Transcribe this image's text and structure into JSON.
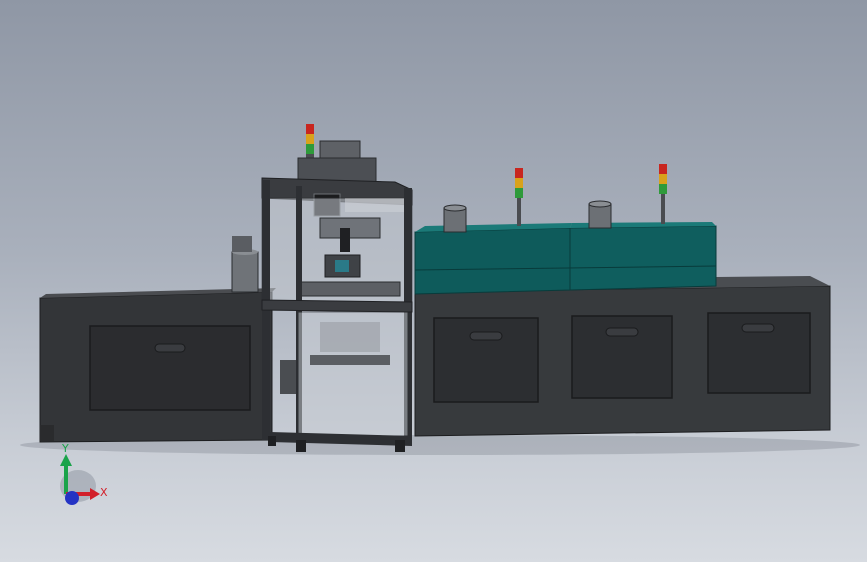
{
  "viewport": {
    "background_top": "#8f97a5",
    "background_bottom": "#d7dbe1"
  },
  "model": {
    "frame_color": "#2d2f33",
    "body_color": "#3b3d40",
    "hood_color": "#0d5a5a",
    "hood_highlight": "#1b7a78",
    "glass_color": "#bfc5cc",
    "signal_tower_colors": [
      "#c8261f",
      "#d9a21b",
      "#2e9a3a"
    ]
  },
  "triad": {
    "x_label": "X",
    "y_label": "Y",
    "x_color": "#d2202a",
    "y_color": "#1aa34a",
    "z_color": "#2433c4"
  }
}
